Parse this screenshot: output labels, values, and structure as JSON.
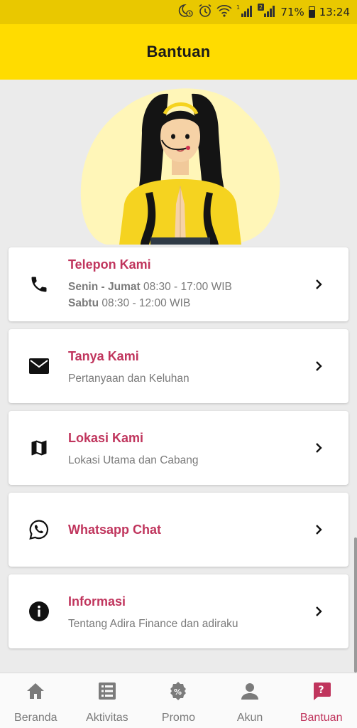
{
  "status_bar": {
    "battery": "71%",
    "time": "13:24",
    "sim1": "1",
    "sim2": "2"
  },
  "app_bar": {
    "title": "Bantuan"
  },
  "menu": {
    "telepon": {
      "title": "Telepon Kami",
      "line1_bold": "Senin - Jumat",
      "line1_text": " 08:30 - 17:00 WIB",
      "line2_bold": "Sabtu",
      "line2_text": " 08:30 - 12:00 WIB"
    },
    "tanya": {
      "title": "Tanya Kami",
      "subtitle": "Pertanyaan dan Keluhan"
    },
    "lokasi": {
      "title": "Lokasi Kami",
      "subtitle": "Lokasi Utama dan Cabang"
    },
    "whatsapp": {
      "title": "Whatsapp Chat"
    },
    "informasi": {
      "title": "Informasi",
      "subtitle": "Tentang Adira Finance dan adiraku"
    }
  },
  "bottom_nav": {
    "beranda": "Beranda",
    "aktivitas": "Aktivitas",
    "promo": "Promo",
    "akun": "Akun",
    "bantuan": "Bantuan"
  },
  "colors": {
    "primary_yellow": "#ffdc00",
    "status_yellow": "#e9c800",
    "accent": "#c0355d"
  },
  "icons": [
    "moon-clock-icon",
    "alarm-icon",
    "wifi-icon",
    "signal-icon",
    "battery-icon",
    "phone-icon",
    "mail-icon",
    "map-icon",
    "whatsapp-icon",
    "info-icon",
    "chevron-right-icon",
    "home-icon",
    "list-icon",
    "promo-badge-icon",
    "person-icon",
    "help-icon"
  ]
}
